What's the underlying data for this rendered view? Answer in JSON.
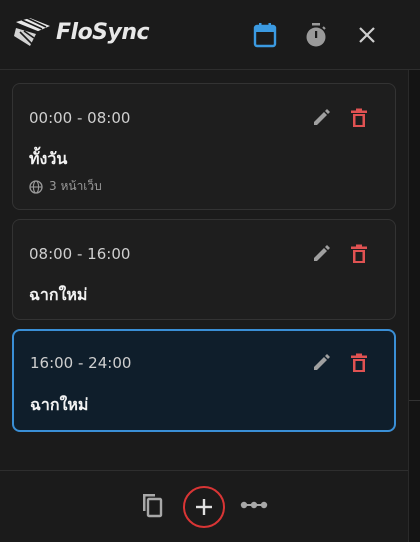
{
  "app": {
    "name": "FloSync"
  },
  "header": {
    "icons": [
      "calendar-icon",
      "timer-icon",
      "close-icon"
    ],
    "active_color": "#3b9ae1"
  },
  "schedules": [
    {
      "time": "00:00 - 08:00",
      "title": "ทั้งวัน",
      "meta": "3 หน้าเว็บ",
      "active": false
    },
    {
      "time": "08:00 - 16:00",
      "title": "ฉากใหม่",
      "meta": "",
      "active": false
    },
    {
      "time": "16:00 - 24:00",
      "title": "ฉากใหม่",
      "meta": "",
      "active": true
    }
  ],
  "footer": {
    "icons": [
      "copy-icon",
      "add-icon",
      "more-icon"
    ],
    "highlight_color": "#d93535"
  },
  "colors": {
    "delete": "#e05252",
    "edit": "#a0a0a0",
    "accent": "#3a8fd6"
  }
}
